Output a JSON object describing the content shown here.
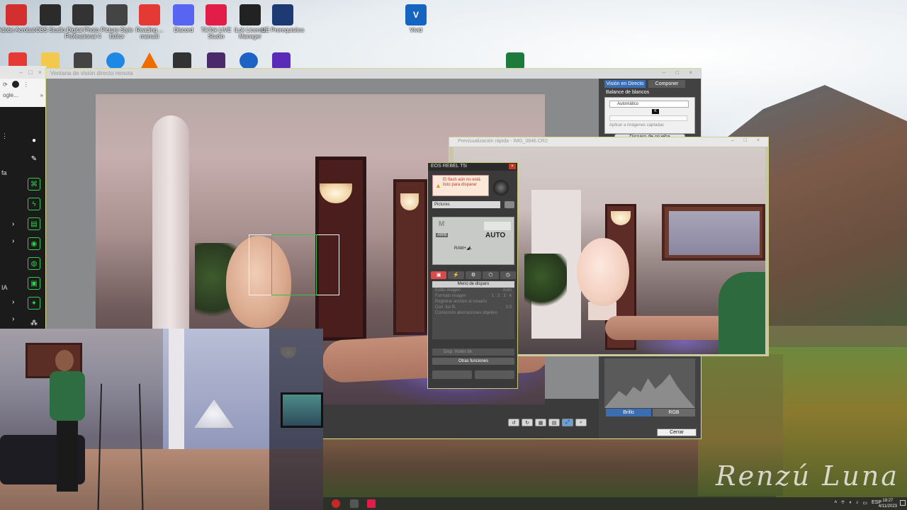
{
  "desktop": {
    "icons": [
      {
        "label": "Adobe Acrobat",
        "icon": "acrobat-icon",
        "color": "#d32f2f"
      },
      {
        "label": "OBS Studio",
        "icon": "obs-icon",
        "color": "#2b2b2b"
      },
      {
        "label": "Digital Photo Professional 4",
        "icon": "dpp-icon",
        "color": "#333333"
      },
      {
        "label": "Picture Style Editor",
        "icon": "picture-style-icon",
        "color": "#444444"
      },
      {
        "label": "Reading ... manual",
        "icon": "pdf-icon",
        "color": "#e53935"
      },
      {
        "label": "Discord",
        "icon": "discord-icon",
        "color": "#5865f2"
      },
      {
        "label": "TikTok LIVE Studio",
        "icon": "tiktok-icon",
        "color": "#e11d48"
      },
      {
        "label": "iLok License Manager",
        "icon": "ilok-icon",
        "color": "#222222"
      },
      {
        "label": "UE Prerequisites",
        "icon": "unreal-icon",
        "color": "#1d3b72"
      }
    ],
    "vivid_icon": {
      "label": "Vivid",
      "icon": "vivid-icon",
      "color": "#1565c0"
    },
    "second_row_icons": [
      "file-icon",
      "folder-icon",
      "camera-icon",
      "teamviewer-icon",
      "vlc-icon",
      "davinci-icon",
      "affinity-icon",
      "app-icon",
      "grid-app-icon",
      "excel-icon"
    ],
    "watermark": "Renzú Luna"
  },
  "browser": {
    "url_fragment": "ogle...",
    "controls": [
      "–",
      "□",
      "×"
    ]
  },
  "toolstrip": {
    "labels": [
      "fa",
      "IA"
    ]
  },
  "live_view": {
    "window_title": "Ventana de visión directo remota",
    "tabs": [
      "Visión en Directo",
      "Componer"
    ],
    "wb_label": "Balance de blancos",
    "wb_value": "Automático",
    "wb_badge": "K",
    "apply_checkbox": "Aplicar a imágenes captadas",
    "test_button": "Disparo de prueba",
    "histogram_tabs": [
      "Brillo",
      "RGB"
    ],
    "close_button": "Cerrar"
  },
  "quick_preview": {
    "window_title": "Previsualización rápida - IMG_0846.CR2"
  },
  "eos": {
    "title": "EOS REBEL T5i",
    "warning": "El flash aún no está listo para disparar",
    "picture_style": "Pictures",
    "mode": "M",
    "wb_badge": "AWB",
    "auto_label": "AUTO",
    "quality": "RAW+◢L",
    "menu_header": "Menú de disparo",
    "menu_items": [
      {
        "label": "Estilo imagen",
        "value": "Auto"
      },
      {
        "label": "Formato imagen",
        "value": "1 : 2 : 3 : 4"
      },
      {
        "label": "Registrar archivo al usuario",
        "value": ""
      },
      {
        "label": "Corr. luz B.",
        "value": "0.0"
      },
      {
        "label": "Corrección aberraciones objetivo",
        "value": ""
      }
    ],
    "lower_label": "Disp. Visión dir.",
    "other_functions": "Otras funciones",
    "tabs": [
      "▣",
      "⚡",
      "⚙",
      "⬡",
      "◷"
    ]
  },
  "taskbar": {
    "lang": "ESP",
    "time": "18:27",
    "date": "4/11/2023"
  }
}
